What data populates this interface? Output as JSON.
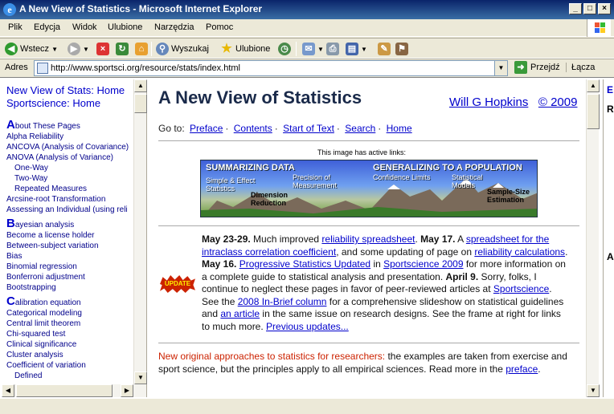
{
  "window": {
    "title": "A New View of Statistics - Microsoft Internet Explorer",
    "buttons": {
      "minimize": "_",
      "maximize": "□",
      "close": "×"
    }
  },
  "menu": [
    "Plik",
    "Edycja",
    "Widok",
    "Ulubione",
    "Narzędzia",
    "Pomoc"
  ],
  "toolbar": {
    "back": "Wstecz",
    "search": "Wyszukaj",
    "favorites": "Ulubione"
  },
  "address": {
    "label": "Adres",
    "url": "http://www.sportsci.org/resource/stats/index.html",
    "go": "Przejdź",
    "links": "Łącza"
  },
  "sidebar": {
    "top_links": [
      "New View of Stats: Home",
      "Sportscience: Home"
    ],
    "groups": [
      {
        "letter": "A",
        "first_rest": "bout These Pages",
        "items": [
          "Alpha Reliability",
          "ANCOVA (Analysis of Covariance)",
          "ANOVA (Analysis of Variance)"
        ],
        "subitems": [
          "One-Way",
          "Two-Way",
          "Repeated Measures"
        ],
        "after": [
          "Arcsine-root Transformation",
          "Assessing an Individual (using reli"
        ]
      },
      {
        "letter": "B",
        "first_rest": "ayesian analysis",
        "items": [
          "Become a license holder",
          "Between-subject variation",
          "Bias",
          "Binomial regression",
          "Bonferroni adjustment",
          "Bootstrapping"
        ]
      },
      {
        "letter": "C",
        "first_rest": "alibration equation",
        "items": [
          "Categorical modeling",
          "Central limit theorem",
          "Chi-squared test",
          "Clinical significance",
          "Cluster analysis",
          "Coefficient of variation"
        ],
        "subitems": [
          "Defined"
        ]
      }
    ]
  },
  "main": {
    "title": "A New View of Statistics",
    "author": "Will G Hopkins",
    "copyright": "© 2009",
    "goto_label": "Go to:",
    "goto_links": [
      "Preface",
      "Contents",
      "Start of Text",
      "Search",
      "Home"
    ],
    "goto_sep": "·",
    "image_caption": "This image has active links:",
    "banner": {
      "left_title": "SUMMARIZING DATA",
      "right_title": "GENERALIZING TO A POPULATION",
      "simple": "Simple & Effect\nStatistics",
      "precision": "Precision of\nMeasurement",
      "dimension": "Dimension\nReduction",
      "confidence": "Confidence Limits",
      "models": "Statistical\nModels",
      "samplesize": "Sample-Size\nEstimation"
    },
    "update_badge": "UPDATE",
    "updates": {
      "d1": "May 23-29.",
      "t1": " Much improved ",
      "l1": "reliability spreadsheet",
      "t2": ". ",
      "d2": "May 17.",
      "t3": " A ",
      "l2": "spreadsheet for the intraclass correlation coefficient",
      "t4": ", and some updating of page on ",
      "l3": "reliability calculations",
      "t5": ". ",
      "d3": "May 16.",
      "t6": " ",
      "l4": "Progressive Statistics Updated",
      "t7": " in ",
      "l5": "Sportscience 2009",
      "t8": " for more information on a complete guide to statistical analysis and presentation. ",
      "d4": "April 9.",
      "t9": " Sorry, folks, I continue to neglect these pages in favor of peer-reviewed articles at ",
      "l6": "Sportscience",
      "t10": ". See the ",
      "l7": "2008 In-Brief column",
      "t11": " for a comprehensive slideshow on statistical guidelines and ",
      "l8": "an article",
      "t12": " in the same issue on research designs. See the frame at right for links to much more. ",
      "l9": "Previous updates..."
    },
    "new_approaches": {
      "red": "New original approaches to statistics for researchers:",
      "text": " the examples are taken from exercise and sport science, but the principles apply to all empirical sciences. Read more in the ",
      "link": "preface",
      "end": "."
    }
  },
  "rightframe": {
    "c1": "E",
    "c2": "R",
    "c3": "A"
  }
}
